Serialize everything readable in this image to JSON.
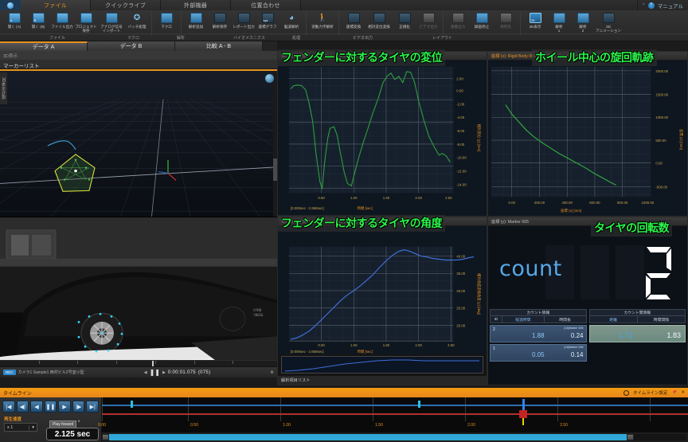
{
  "ribbon": {
    "tabs": [
      {
        "label": "ファイル",
        "active": true
      },
      {
        "label": "クイックライブ",
        "active": false
      },
      {
        "label": "外部機器",
        "active": false
      },
      {
        "label": "位置合わせ",
        "active": false
      }
    ],
    "manual_label": "マニュアル",
    "groups": [
      {
        "title": "ファイル",
        "buttons": [
          {
            "label": "開く (A)",
            "icon": "open-a-icon"
          },
          {
            "label": "開く (B)",
            "icon": "open-b-icon"
          },
          {
            "label": "ファイル出力",
            "icon": "file-export-icon"
          },
          {
            "label": "プロジェクト\n保存",
            "icon": "project-save-icon"
          },
          {
            "label": "アナログ信号\nインポート",
            "icon": "analog-import-icon"
          },
          {
            "label": "バッチ処理",
            "icon": "batch-process-icon"
          }
        ]
      },
      {
        "title": "マクロ",
        "buttons": [
          {
            "label": "マクロ",
            "icon": "macro-icon"
          }
        ]
      },
      {
        "title": "解析",
        "buttons": [
          {
            "label": "解析追加",
            "icon": "analysis-add-icon"
          },
          {
            "label": "解析保存",
            "icon": "analysis-save-icon"
          },
          {
            "label": "レポート出力",
            "icon": "report-export-icon"
          },
          {
            "label": "座標グラフ",
            "icon": "coordinate-graph-icon"
          },
          {
            "label": "脳波解析",
            "icon": "brainwave-icon"
          }
        ]
      },
      {
        "title": "バイオメカニクス",
        "buttons": [
          {
            "label": "逆動力学解析",
            "icon": "inverse-dynamics-icon"
          }
        ]
      },
      {
        "title": "処理",
        "buttons": [
          {
            "label": "座標変換",
            "icon": "coordinate-transform-icon"
          },
          {
            "label": "相対変位変換",
            "icon": "relative-transform-icon"
          },
          {
            "label": "正規化",
            "icon": "normalize-icon"
          },
          {
            "label": "ビデオ出力",
            "icon": "video-out-dim-icon"
          }
        ]
      },
      {
        "title": "ビデオ出力",
        "buttons": [
          {
            "label": "連番出力",
            "icon": "sequence-export-icon"
          },
          {
            "label": "録画停止",
            "icon": "record-stop-icon"
          },
          {
            "label": "保存先",
            "icon": "save-dest-icon"
          }
        ]
      },
      {
        "title": "レイアウト",
        "buttons": [
          {
            "label": "3D表示",
            "icon": "layout-3d-icon"
          },
          {
            "label": "解析\n1",
            "icon": "layout-analysis1-icon"
          },
          {
            "label": "解析\n2",
            "icon": "layout-analysis2-icon"
          },
          {
            "label": "3D\nアニメーション",
            "icon": "layout-3danim-icon"
          }
        ]
      }
    ],
    "footers": [
      "ファイル",
      "マクロ",
      "解析",
      "バイオメカニクス",
      "処理",
      "ビデオ出力",
      "レイアウト"
    ]
  },
  "data_tabs": [
    {
      "label": "データ A",
      "active": true
    },
    {
      "label": "データ B",
      "active": false
    },
    {
      "label": "比較 A - B",
      "active": false
    }
  ],
  "left_panel": {
    "subtitle": "3D表示",
    "marker_list_label": "マーカーリスト",
    "side_tab_label": "3D表示/計測"
  },
  "video": {
    "timecode": "0:00:01.075",
    "frame": "(075)",
    "chip": "REC",
    "file_label": "カメラ1 Sample1 西村ビル2号室小型"
  },
  "annotations": {
    "displacement": "フェンダーに対するタイヤの変位",
    "trajectory": "ホイール中心の旋回軌跡",
    "angle": "フェンダーに対するタイヤの角度",
    "rotations": "タイヤの回転数"
  },
  "panels": {
    "p1": {
      "header": "相対変位変換 (y): Rigid Body 001-Rigid Body 002",
      "range": "[0.000sec - 2.858sec]"
    },
    "p2": {
      "header_a": "座標 (x): Rigid Body 001",
      "header_b": "座標 (z): Rigid Body 001"
    },
    "p3": {
      "header": "相対角度変換角度 (y): Rigid Body 002-Rigid Body 001",
      "range": "[0.000sec - 2.858sec]",
      "footer": "解析項目リスト"
    },
    "p4": {
      "header": "座標 (y): Marker 005"
    }
  },
  "count": {
    "word": "count",
    "value": "2",
    "table_left": {
      "title": "カウント情報",
      "columns": [
        "ID",
        "経過時間",
        "時間長"
      ],
      "rows": [
        {
          "id": "2",
          "elapsed": "1.88",
          "duration": "0.24",
          "tag": "[14]Marker 005"
        },
        {
          "id": "1",
          "elapsed": "0.05",
          "duration": "0.14",
          "tag": "[14]Marker 005"
        }
      ]
    },
    "table_right": {
      "title": "カウント間情報",
      "columns": [
        "距離",
        "時間間隔"
      ],
      "rows": [
        {
          "distance": "1.71",
          "interval": "1.83"
        }
      ]
    }
  },
  "timeline": {
    "title": "タイムライン",
    "settings_label": "タイムライン設定",
    "speed_label": "再生速度",
    "speed_value": "x 1",
    "tooltip": "Play foward",
    "tooltip_sup": "5",
    "current_time": "2.125 sec",
    "ticks": [
      "0.00",
      "0.50",
      "1.00",
      "1.50",
      "2.00",
      "2.50"
    ],
    "buttons": [
      {
        "name": "go-to-start-button",
        "glyph": "|◀"
      },
      {
        "name": "step-back-button",
        "glyph": "◀|"
      },
      {
        "name": "play-backward-button",
        "glyph": "◀"
      },
      {
        "name": "pause-button",
        "glyph": "❚❚"
      },
      {
        "name": "play-forward-button",
        "glyph": "▶"
      },
      {
        "name": "step-forward-button",
        "glyph": "|▶"
      },
      {
        "name": "go-to-end-button",
        "glyph": "▶|"
      }
    ]
  },
  "chart_data": [
    {
      "id": "displacement",
      "type": "line",
      "title": "相対変位変換 (y): Rigid Body 001-Rigid Body 002",
      "xlabel": "時間 [sec]",
      "ylabel": "相対変位 (y) [mm]",
      "xlim": [
        0.0,
        2.858
      ],
      "ylim": [
        -15.0,
        3.5
      ],
      "xticks": [
        0.5,
        1.0,
        1.5,
        2.0,
        2.5
      ],
      "yticks": [
        2.0,
        0.0,
        -2.0,
        -4.0,
        -6.0,
        -8.0,
        -10.0,
        -12.0,
        -14.0
      ],
      "grid": true,
      "color": "#2f9e3f",
      "x": [
        0.0,
        0.06,
        0.12,
        0.18,
        0.24,
        0.3,
        0.36,
        0.42,
        0.48,
        0.52,
        0.56,
        0.6,
        0.64,
        0.7,
        0.76,
        0.82,
        0.88,
        0.94,
        1.0,
        1.06,
        1.12,
        1.2,
        1.28,
        1.36,
        1.44,
        1.52,
        1.58,
        1.64,
        1.7,
        1.76,
        1.82,
        1.88,
        1.94,
        2.0,
        2.06,
        2.14,
        2.22,
        2.3,
        2.38,
        2.44,
        2.5,
        2.58,
        2.66,
        2.74,
        2.82
      ],
      "y": [
        0.1,
        0.55,
        0.75,
        0.7,
        0.3,
        -1.2,
        -4.0,
        -8.5,
        -13.5,
        -14.7,
        -11.0,
        -7.4,
        -5.8,
        -5.6,
        -7.0,
        -9.6,
        -12.6,
        -14.3,
        -14.6,
        -12.8,
        -10.6,
        -8.2,
        -6.0,
        -3.6,
        -1.0,
        1.6,
        2.6,
        3.1,
        2.2,
        2.6,
        1.7,
        3.3,
        3.2,
        1.6,
        -1.2,
        -4.3,
        -6.6,
        -8.2,
        -9.5,
        -9.3,
        -9.6,
        -10.6,
        -11.4,
        -11.7,
        -11.9
      ]
    },
    {
      "id": "trajectory",
      "type": "line",
      "title": "座標 (x) vs 座標 (z): Rigid Body 001",
      "xlabel": "座標 (x) [mm]",
      "ylabel": "座標 (z) [mm]",
      "xlim": [
        -150,
        1100
      ],
      "ylim": [
        -700,
        2200
      ],
      "xticks": [
        0.0,
        200.0,
        400.0,
        600.0,
        800.0,
        1000.0
      ],
      "yticks": [
        2000.0,
        1500.0,
        1000.0,
        500.0,
        0.0,
        -500.0
      ],
      "grid": true,
      "color": "#2f9e3f",
      "x": [
        -60,
        0,
        60,
        130,
        200,
        280,
        360,
        440,
        520,
        600,
        680,
        760,
        840,
        900,
        950
      ],
      "y": [
        1330,
        1140,
        980,
        840,
        720,
        610,
        500,
        400,
        300,
        200,
        105,
        10,
        -80,
        -160,
        -230
      ]
    },
    {
      "id": "angle",
      "type": "line",
      "title": "相対角度変換角度 (y): Rigid Body 002-Rigid Body 001",
      "xlabel": "時間 [sec]",
      "ylabel": "相対角度変換角度 (y) [deg]",
      "xlim": [
        0.0,
        2.858
      ],
      "ylim": [
        17.5,
        44.0
      ],
      "xticks": [
        0.5,
        1.0,
        1.5,
        2.0,
        2.5
      ],
      "yticks": [
        40.0,
        35.0,
        30.0,
        25.0,
        20.0
      ],
      "grid": true,
      "color": "#3f6fd8",
      "x": [
        0.0,
        0.1,
        0.2,
        0.3,
        0.4,
        0.5,
        0.6,
        0.7,
        0.8,
        0.9,
        1.0,
        1.1,
        1.2,
        1.3,
        1.4,
        1.5,
        1.6,
        1.7,
        1.78,
        1.86,
        1.94,
        2.02,
        2.1,
        2.2,
        2.3,
        2.4,
        2.5,
        2.6,
        2.7,
        2.8,
        2.858
      ],
      "y": [
        17.9,
        18.3,
        19.1,
        20.3,
        21.8,
        23.4,
        25.2,
        27.1,
        29.0,
        30.6,
        32.0,
        33.4,
        34.9,
        36.6,
        38.6,
        40.6,
        42.3,
        43.4,
        43.7,
        43.3,
        42.6,
        42.0,
        41.6,
        41.2,
        41.0,
        40.9,
        40.8,
        40.8,
        41.0,
        41.3,
        41.6
      ]
    },
    {
      "id": "count",
      "type": "table",
      "title": "座標 (y): Marker 005",
      "value": 2,
      "columns": [
        "ID",
        "経過時間",
        "時間長"
      ],
      "rows": [
        [
          "2",
          "1.88",
          "0.24"
        ],
        [
          "1",
          "0.05",
          "0.14"
        ]
      ],
      "interval_columns": [
        "距離",
        "時間間隔"
      ],
      "interval_rows": [
        [
          "1.71",
          "1.83"
        ]
      ]
    }
  ]
}
